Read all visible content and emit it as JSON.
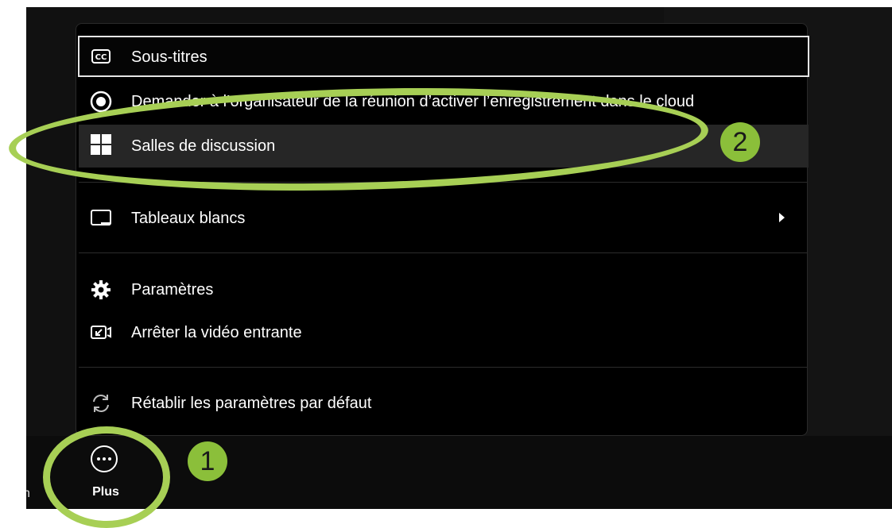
{
  "menu": {
    "items": [
      {
        "label": "Sous-titres",
        "icon": "closed-captions-icon"
      },
      {
        "label": "Demander à l’organisateur de la réunion d’activer l’enregistrement dans le cloud",
        "icon": "record-icon"
      },
      {
        "label": "Salles de discussion",
        "icon": "breakout-rooms-icon"
      },
      {
        "label": "Tableaux blancs",
        "icon": "whiteboard-icon"
      },
      {
        "label": "Paramètres",
        "icon": "gear-icon"
      },
      {
        "label": "Arrêter la vidéo entrante",
        "icon": "stop-incoming-video-icon"
      },
      {
        "label": "Rétablir les paramètres par défaut",
        "icon": "reset-icon"
      }
    ]
  },
  "toolbar": {
    "plus_label": "Plus",
    "edge_text": "n"
  },
  "annotations": {
    "step1": "1",
    "step2": "2"
  },
  "colors": {
    "highlight": "#a7cf55",
    "badge": "#8bbf3a"
  }
}
